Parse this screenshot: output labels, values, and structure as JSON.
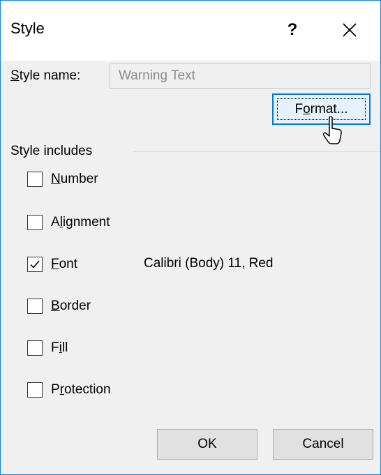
{
  "dialog": {
    "title": "Style",
    "help_label": "?",
    "close_icon": "close-icon"
  },
  "style_name": {
    "label_accel": "S",
    "label_rest": "tyle name:",
    "value": "Warning Text"
  },
  "format_button": {
    "pre": "F",
    "accel": "o",
    "post": "rmat..."
  },
  "style_includes": {
    "label": "Style includes",
    "items": [
      {
        "pre": "",
        "accel": "N",
        "post": "umber",
        "checked": false
      },
      {
        "pre": "A",
        "accel": "l",
        "post": "ignment",
        "checked": false
      },
      {
        "pre": "",
        "accel": "F",
        "post": "ont",
        "checked": true,
        "description": "Calibri (Body) 11, Red"
      },
      {
        "pre": "",
        "accel": "B",
        "post": "order",
        "checked": false
      },
      {
        "pre": "F",
        "accel": "i",
        "post": "ll",
        "checked": false
      },
      {
        "pre": "P",
        "accel": "r",
        "post": "otection",
        "checked": false
      }
    ]
  },
  "buttons": {
    "ok": "OK",
    "cancel": "Cancel"
  },
  "colors": {
    "accent": "#0078d7",
    "window_border": "#1883d7",
    "background": "#f0f0f0"
  }
}
